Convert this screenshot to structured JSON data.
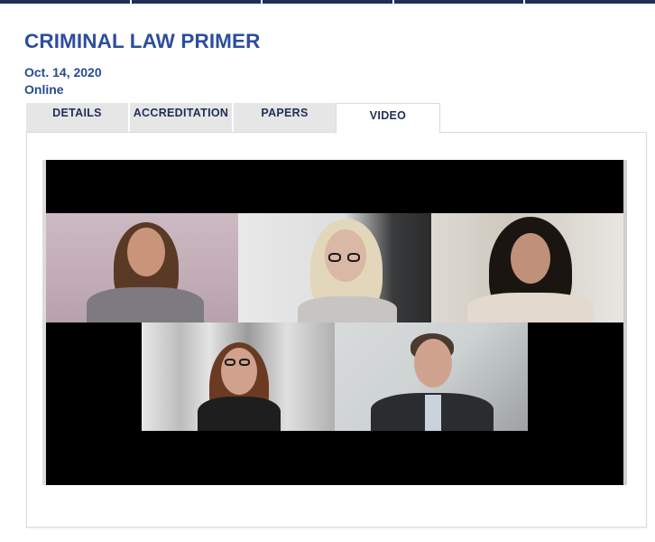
{
  "event": {
    "title": "CRIMINAL LAW PRIMER",
    "date": "Oct. 14, 2020",
    "location": "Online"
  },
  "tabs": [
    {
      "label": "DETAILS",
      "active": false
    },
    {
      "label": "ACCREDITATION",
      "active": false
    },
    {
      "label": "PAPERS",
      "active": false
    },
    {
      "label": "VIDEO",
      "active": true
    }
  ],
  "colors": {
    "nav": "#1f2f56",
    "title": "#2d4d9c",
    "tab_bg": "#e6e6e6"
  },
  "video": {
    "participants": 5
  }
}
